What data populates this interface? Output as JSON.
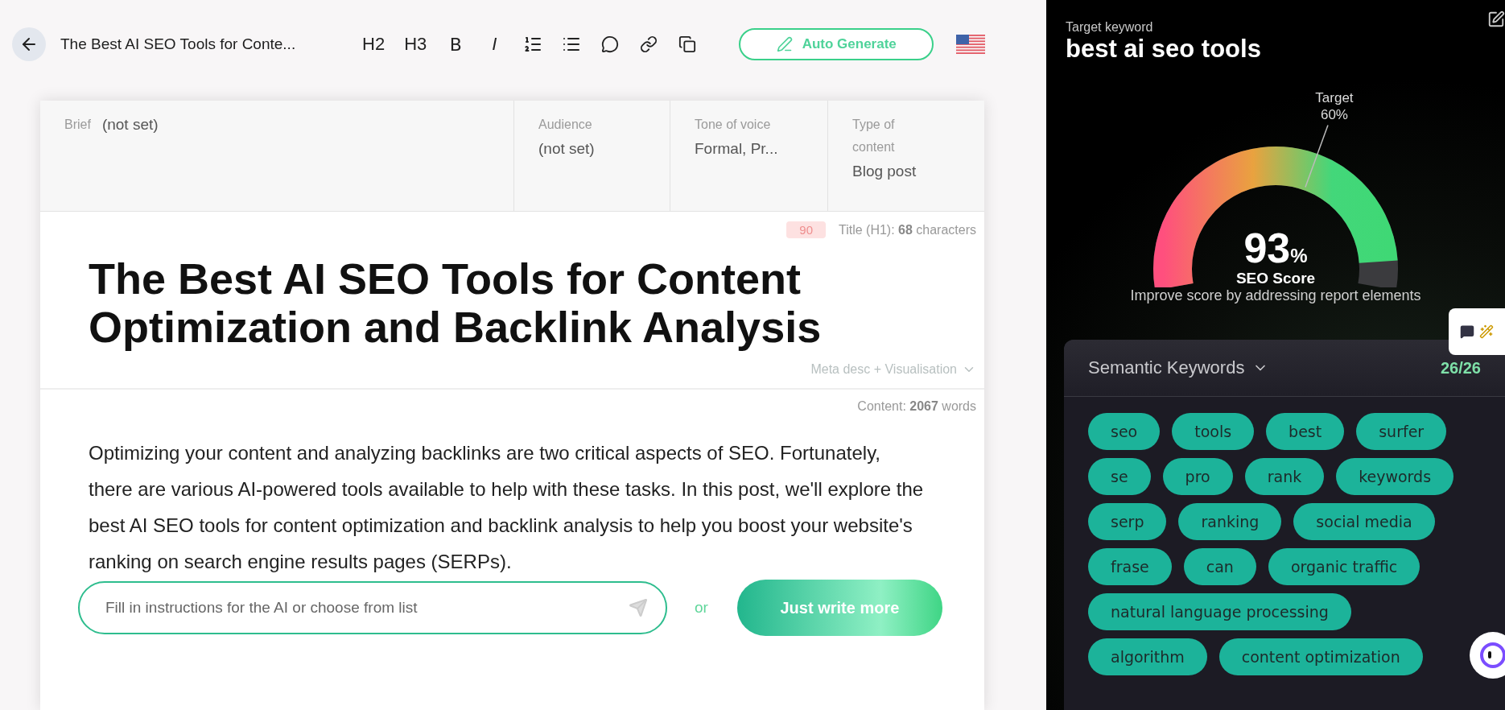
{
  "toolbar": {
    "document_title": "The Best AI SEO Tools for Conte...",
    "tools": [
      {
        "kind": "text",
        "label": "H2"
      },
      {
        "kind": "text",
        "label": "H3"
      },
      {
        "kind": "bold",
        "label": "B"
      },
      {
        "kind": "italic",
        "label": "I"
      },
      {
        "kind": "ordered-list"
      },
      {
        "kind": "bullet-list"
      },
      {
        "kind": "comment"
      },
      {
        "kind": "link"
      },
      {
        "kind": "copy"
      }
    ],
    "auto_generate": "Auto Generate"
  },
  "brief": [
    {
      "label": "Brief",
      "value": "(not set)"
    },
    {
      "label": "Audience",
      "value": "(not set)"
    },
    {
      "label": "Tone of voice",
      "value": "Formal, Pr..."
    },
    {
      "label": "Type of content",
      "value": "Blog post"
    }
  ],
  "title_meta": {
    "badge": "90",
    "count": "Title (H1): **68** characters"
  },
  "title": "The Best AI SEO Tools for Content Optimization and Backlink Analysis",
  "meta_toggle": "Meta desc + Visualisation",
  "content_count": "Content: **2067** words",
  "paragraph": "Optimizing your content and analyzing backlinks are two critical aspects of SEO. Fortunately, there are various AI-powered tools available to help with these tasks. In this post, we'll explore the best AI SEO tools for content optimization and backlink analysis to help you boost your website's ranking on search engine results pages (SERPs).",
  "ai_bar": {
    "placeholder": "Fill in instructions for the AI or choose from list",
    "or": "or",
    "button": "Just write more"
  },
  "side": {
    "keyword_label": "Target keyword",
    "keyword": "best ai seo tools",
    "gauge": {
      "target_label": "Target",
      "target_value": "60%",
      "score": "93",
      "unit": "%",
      "caption": "SEO Score"
    },
    "hint": "Improve score by addressing report elements",
    "semantic": {
      "title": "Semantic Keywords",
      "count": "26/26",
      "keywords": [
        "seo",
        "tools",
        "best",
        "surfer",
        "se",
        "pro",
        "rank",
        "keywords",
        "serp",
        "ranking",
        "social media",
        "frase",
        "can",
        "organic traffic",
        "natural language processing",
        "algorithm",
        "content optimization"
      ]
    }
  }
}
